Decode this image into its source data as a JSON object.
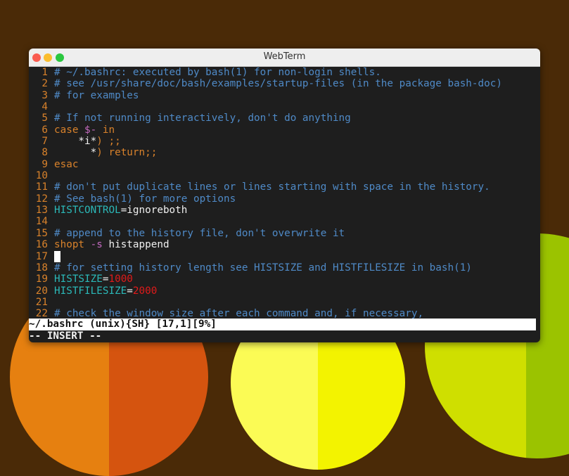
{
  "window": {
    "title": "WebTerm"
  },
  "colors": {
    "background": "#4a2a07",
    "comment": "#4f8ac7",
    "keyword": "#d9822b",
    "variable": "#2bb8b8",
    "number": "#e01a1a",
    "operator": "#c46ac0",
    "line_number": "#d9822b"
  },
  "editor": {
    "lines": [
      {
        "num": "1",
        "segments": [
          {
            "text": "# ~/.bashrc: executed by bash(1) for non-login shells.",
            "cls": "comment"
          }
        ]
      },
      {
        "num": "2",
        "segments": [
          {
            "text": "# see /usr/share/doc/bash/examples/startup-files (in the package bash-doc)",
            "cls": "comment"
          }
        ]
      },
      {
        "num": "3",
        "segments": [
          {
            "text": "# for examples",
            "cls": "comment"
          }
        ]
      },
      {
        "num": "4",
        "segments": []
      },
      {
        "num": "5",
        "segments": [
          {
            "text": "# If not running interactively, don't do anything",
            "cls": "comment"
          }
        ]
      },
      {
        "num": "6",
        "segments": [
          {
            "text": "case ",
            "cls": "keyword"
          },
          {
            "text": "$-",
            "cls": "op"
          },
          {
            "text": " in",
            "cls": "keyword"
          }
        ]
      },
      {
        "num": "7",
        "segments": [
          {
            "text": "    *i*",
            "cls": "plain"
          },
          {
            "text": ") ;;",
            "cls": "keyword"
          }
        ]
      },
      {
        "num": "8",
        "segments": [
          {
            "text": "      *",
            "cls": "plain"
          },
          {
            "text": ") return;;",
            "cls": "keyword"
          }
        ]
      },
      {
        "num": "9",
        "segments": [
          {
            "text": "esac",
            "cls": "keyword"
          }
        ]
      },
      {
        "num": "10",
        "segments": []
      },
      {
        "num": "11",
        "segments": [
          {
            "text": "# don't put duplicate lines or lines starting with space in the history.",
            "cls": "comment"
          }
        ]
      },
      {
        "num": "12",
        "segments": [
          {
            "text": "# See bash(1) for more options",
            "cls": "comment"
          }
        ]
      },
      {
        "num": "13",
        "segments": [
          {
            "text": "HISTCONTROL",
            "cls": "var"
          },
          {
            "text": "=ignoreboth",
            "cls": "plain"
          }
        ]
      },
      {
        "num": "14",
        "segments": []
      },
      {
        "num": "15",
        "segments": [
          {
            "text": "# append to the history file, don't overwrite it",
            "cls": "comment"
          }
        ]
      },
      {
        "num": "16",
        "segments": [
          {
            "text": "shopt ",
            "cls": "keyword"
          },
          {
            "text": "-s",
            "cls": "op"
          },
          {
            "text": " histappend",
            "cls": "plain"
          }
        ]
      },
      {
        "num": "17",
        "segments": [],
        "cursor": true
      },
      {
        "num": "18",
        "segments": [
          {
            "text": "# for setting history length see HISTSIZE and HISTFILESIZE in bash(1)",
            "cls": "comment"
          }
        ]
      },
      {
        "num": "19",
        "segments": [
          {
            "text": "HISTSIZE",
            "cls": "var"
          },
          {
            "text": "=",
            "cls": "plain"
          },
          {
            "text": "1000",
            "cls": "num"
          }
        ]
      },
      {
        "num": "20",
        "segments": [
          {
            "text": "HISTFILESIZE",
            "cls": "var"
          },
          {
            "text": "=",
            "cls": "plain"
          },
          {
            "text": "2000",
            "cls": "num"
          }
        ]
      },
      {
        "num": "21",
        "segments": []
      },
      {
        "num": "22",
        "segments": [
          {
            "text": "# check the window size after each command and, if necessary,",
            "cls": "comment"
          }
        ]
      }
    ],
    "status_line": "~/.bashrc (unix){SH} [17,1][9%]",
    "mode_line": "-- INSERT --"
  }
}
